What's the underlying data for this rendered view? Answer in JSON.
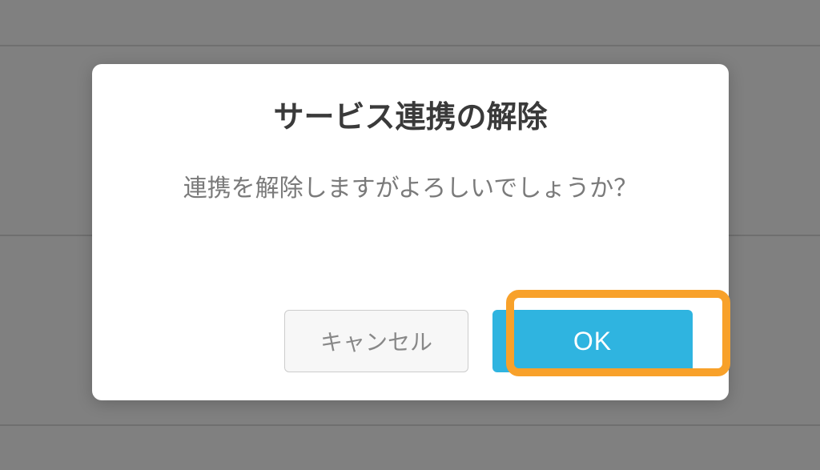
{
  "dialog": {
    "title": "サービス連携の解除",
    "message": "連携を解除しますがよろしいでしょうか？",
    "cancel_label": "キャンセル",
    "ok_label": "OK"
  }
}
